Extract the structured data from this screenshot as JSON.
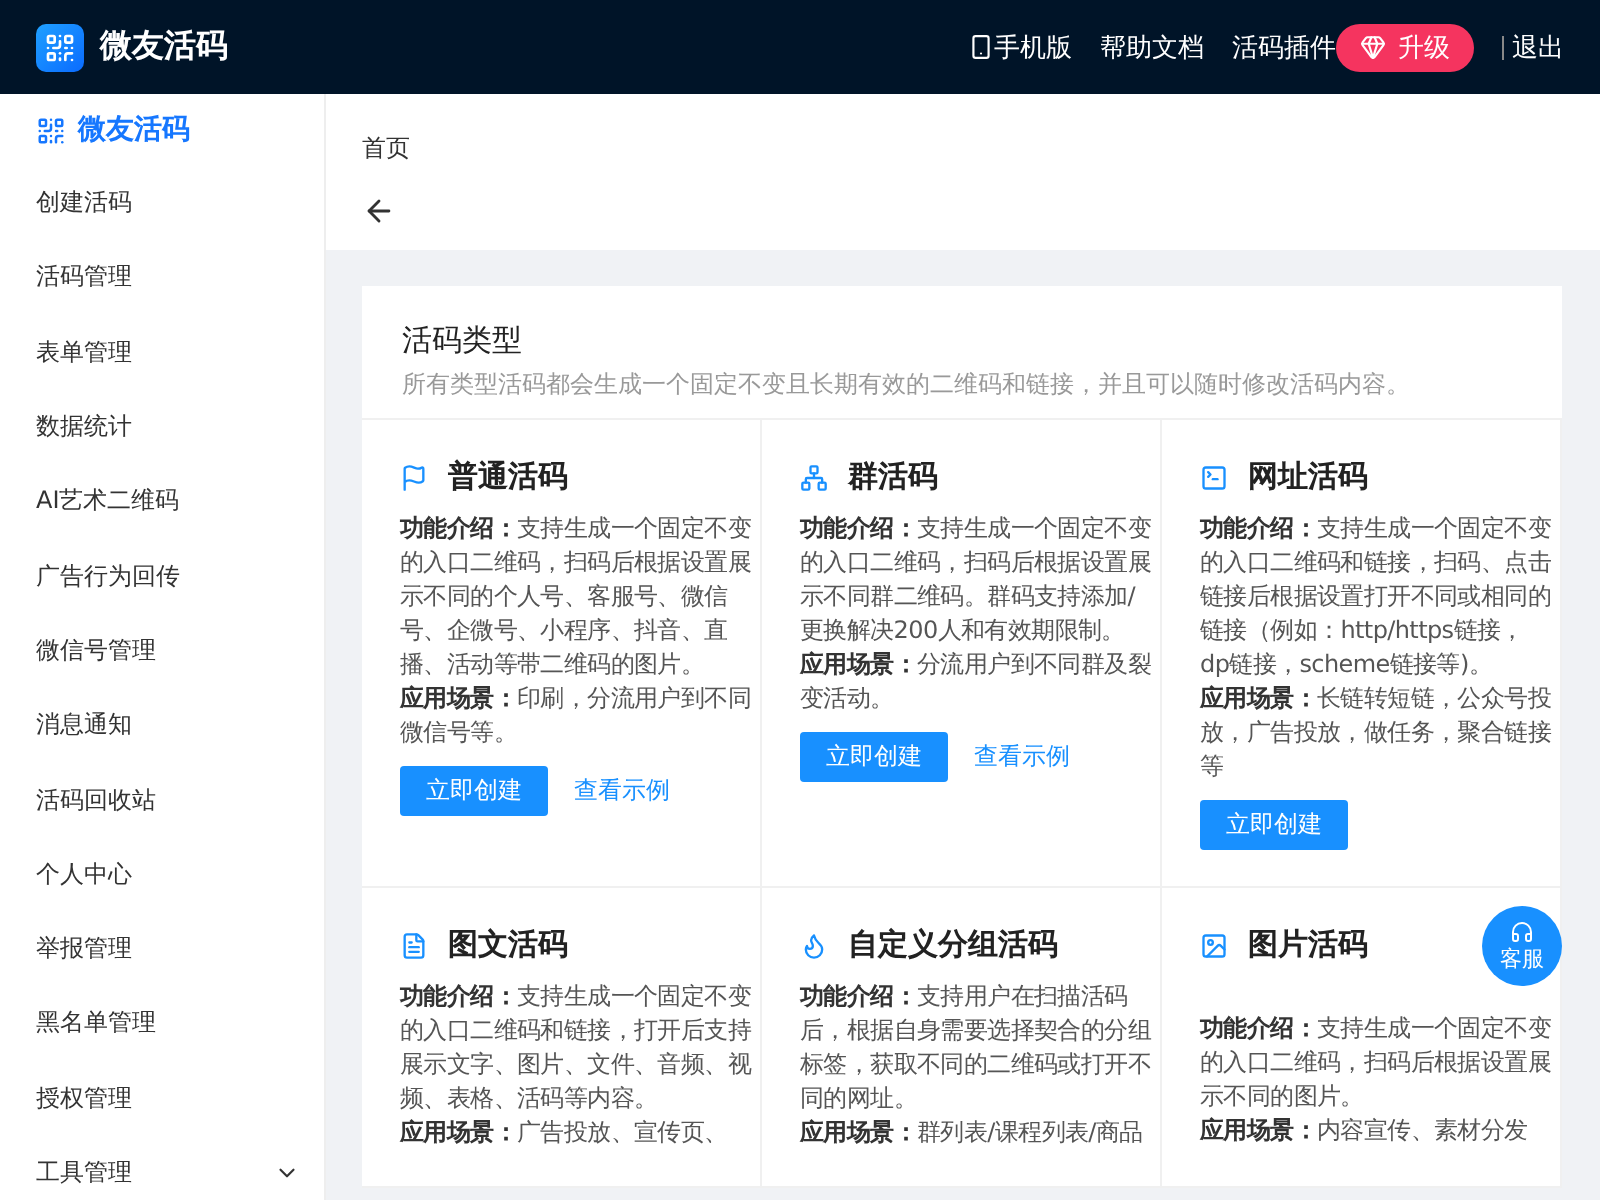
{
  "topbar": {
    "brand": "微友活码",
    "links": [
      {
        "label": "手机版",
        "kind": "phone"
      },
      {
        "label": "帮助文档",
        "kind": "text"
      },
      {
        "label": "活码插件",
        "kind": "text"
      }
    ],
    "upgrade": "升级",
    "logout": "退出"
  },
  "sidebar": {
    "brand": "微友活码",
    "items": [
      {
        "label": "创建活码",
        "kind": "link"
      },
      {
        "label": "活码管理",
        "kind": "link"
      },
      {
        "label": "表单管理",
        "kind": "link"
      },
      {
        "label": "数据统计",
        "kind": "link"
      },
      {
        "label": "AI艺术二维码",
        "kind": "link"
      },
      {
        "label": "广告行为回传",
        "kind": "link"
      },
      {
        "label": "微信号管理",
        "kind": "link"
      },
      {
        "label": "消息通知",
        "kind": "link"
      },
      {
        "label": "活码回收站",
        "kind": "link"
      },
      {
        "label": "个人中心",
        "kind": "link"
      },
      {
        "label": "举报管理",
        "kind": "link"
      },
      {
        "label": "黑名单管理",
        "kind": "link"
      },
      {
        "label": "授权管理",
        "kind": "link"
      },
      {
        "label": "工具管理",
        "kind": "group"
      }
    ]
  },
  "breadcrumb": "首页",
  "panel": {
    "title": "活码类型",
    "subtitle": "所有类型活码都会生成一个固定不变且长期有效的二维码和链接，并且可以随时修改活码内容。",
    "types": [
      {
        "title": "普通活码",
        "intro": "**功能介绍：**支持生成一个固定不变的入口二维码，扫码后根据设置展示不同的个人号、客服号、微信号、企微号、小程序、抖音、直播、活动等带二维码的图片。",
        "usage": "**应用场景：**印刷，分流用户到不同微信号等。",
        "create": "立即创建",
        "example": "查看示例"
      },
      {
        "title": "群活码",
        "intro": "**功能介绍：**支持生成一个固定不变的入口二维码，扫码后根据设置展示不同群二维码。群码支持添加/更换解决200人和有效期限制。",
        "usage": "**应用场景：**分流用户到不同群及裂变活动。",
        "create": "立即创建",
        "example": "查看示例"
      },
      {
        "title": "网址活码",
        "intro": "**功能介绍：**支持生成一个固定不变的入口二维码和链接，扫码、点击链接后根据设置打开不同或相同的链接（例如：http/https链接，dp链接，scheme链接等)。",
        "usage": "**应用场景：**长链转短链，公众号投放，广告投放，做任务，聚合链接等",
        "create": "立即创建"
      },
      {
        "title": "图文活码",
        "intro": "**功能介绍：**支持生成一个固定不变的入口二维码和链接，打开后支持展示文字、图片、文件、音频、视频、表格、活码等内容。",
        "usage": "**应用场景：**广告投放、宣传页、"
      },
      {
        "title": "自定义分组活码",
        "intro": "**功能介绍：**支持用户在扫描活码后，根据自身需要选择契合的分组标签，获取不同的二维码或打开不同的网址。",
        "usage": "**应用场景：**群列表/课程列表/商品"
      },
      {
        "title": "图片活码",
        "intro": "**功能介绍：**支持生成一个固定不变的入口二维码，扫码后根据设置展示不同的图片。",
        "usage": "**应用场景：**内容宣传、素材分发"
      }
    ]
  },
  "support": "客服"
}
